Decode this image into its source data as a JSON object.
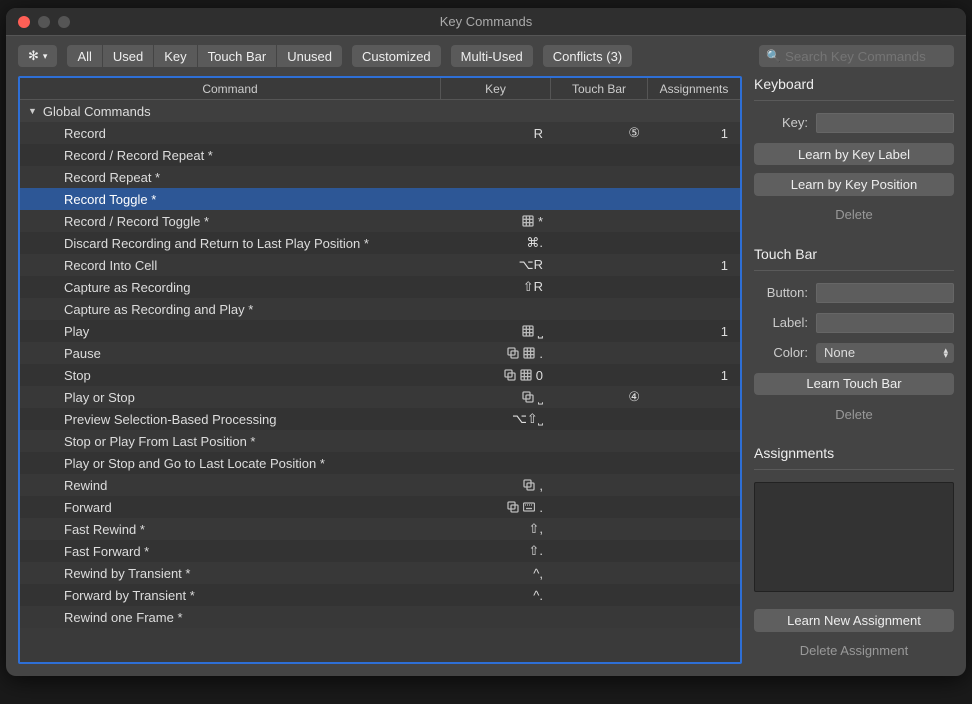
{
  "window_title": "Key Commands",
  "toolbar": {
    "segments": [
      "All",
      "Used",
      "Key",
      "Touch Bar",
      "Unused"
    ],
    "customized": "Customized",
    "multiused": "Multi-Used",
    "conflicts": "Conflicts (3)",
    "search_placeholder": "Search Key Commands"
  },
  "columns": {
    "command": "Command",
    "key": "Key",
    "touchbar": "Touch Bar",
    "assignments": "Assignments"
  },
  "group": "Global Commands",
  "rows": [
    {
      "command": "Record",
      "key": "R",
      "touchbar": "⑤",
      "assign": "1",
      "icons": []
    },
    {
      "command": "Record / Record Repeat *",
      "key": "",
      "touchbar": "",
      "assign": "",
      "icons": []
    },
    {
      "command": "Record Repeat *",
      "key": "",
      "touchbar": "",
      "assign": "",
      "icons": []
    },
    {
      "command": "Record Toggle *",
      "key": "",
      "touchbar": "",
      "assign": "",
      "icons": [],
      "selected": true
    },
    {
      "command": "Record / Record Toggle *",
      "key": "*",
      "touchbar": "",
      "assign": "",
      "icons": [
        "grid"
      ]
    },
    {
      "command": "Discard Recording and Return to Last Play Position *",
      "key": "⌘.",
      "touchbar": "",
      "assign": "",
      "icons": []
    },
    {
      "command": "Record Into Cell",
      "key": "⌥R",
      "touchbar": "",
      "assign": "1",
      "icons": []
    },
    {
      "command": "Capture as Recording",
      "key": "⇧R",
      "touchbar": "",
      "assign": "",
      "icons": []
    },
    {
      "command": "Capture as Recording and Play *",
      "key": "",
      "touchbar": "",
      "assign": "",
      "icons": []
    },
    {
      "command": "Play",
      "key": "⎵",
      "touchbar": "",
      "assign": "1",
      "icons": [
        "grid"
      ]
    },
    {
      "command": "Pause",
      "key": ".",
      "touchbar": "",
      "assign": "",
      "icons": [
        "copy",
        "grid"
      ]
    },
    {
      "command": "Stop",
      "key": "0",
      "touchbar": "",
      "assign": "1",
      "icons": [
        "copy",
        "grid"
      ]
    },
    {
      "command": "Play or Stop",
      "key": "˽",
      "touchbar": "④",
      "assign": "",
      "icons": [
        "copy"
      ]
    },
    {
      "command": "Preview Selection-Based Processing",
      "key": "⌥⇧˽",
      "touchbar": "",
      "assign": "",
      "icons": []
    },
    {
      "command": "Stop or Play From Last Position *",
      "key": "",
      "touchbar": "",
      "assign": "",
      "icons": []
    },
    {
      "command": "Play or Stop and Go to Last Locate Position *",
      "key": "",
      "touchbar": "",
      "assign": "",
      "icons": []
    },
    {
      "command": "Rewind",
      "key": ",",
      "touchbar": "",
      "assign": "",
      "icons": [
        "copy"
      ]
    },
    {
      "command": "Forward",
      "key": ".",
      "touchbar": "",
      "assign": "",
      "icons": [
        "copy",
        "keyboard"
      ]
    },
    {
      "command": "Fast Rewind *",
      "key": "⇧,",
      "touchbar": "",
      "assign": "",
      "icons": []
    },
    {
      "command": "Fast Forward *",
      "key": "⇧.",
      "touchbar": "",
      "assign": "",
      "icons": []
    },
    {
      "command": "Rewind by Transient *",
      "key": "^,",
      "touchbar": "",
      "assign": "",
      "icons": []
    },
    {
      "command": "Forward by Transient *",
      "key": "^.",
      "touchbar": "",
      "assign": "",
      "icons": []
    },
    {
      "command": "Rewind one Frame *",
      "key": "",
      "touchbar": "",
      "assign": "",
      "icons": []
    }
  ],
  "sidebar": {
    "keyboard": {
      "title": "Keyboard",
      "key_label": "Key:",
      "learn_label": "Learn by Key Label",
      "learn_position": "Learn by Key Position",
      "delete": "Delete"
    },
    "touchbar": {
      "title": "Touch Bar",
      "button_label": "Button:",
      "label_label": "Label:",
      "color_label": "Color:",
      "color_value": "None",
      "learn": "Learn Touch Bar",
      "delete": "Delete"
    },
    "assignments": {
      "title": "Assignments",
      "learn": "Learn New Assignment",
      "delete": "Delete Assignment"
    }
  }
}
